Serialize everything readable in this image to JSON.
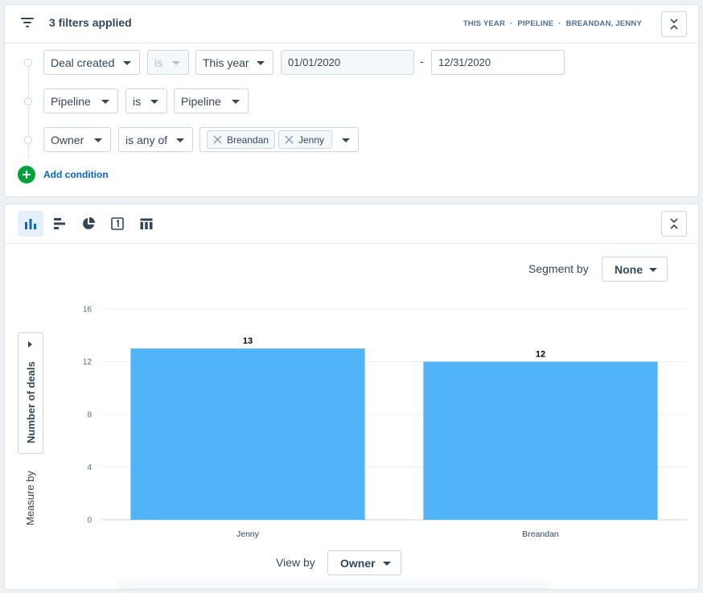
{
  "filters": {
    "title": "3 filters applied",
    "summary": [
      "THIS YEAR",
      "PIPELINE",
      "BREANDAN, JENNY"
    ],
    "rows": [
      {
        "field": "Deal created",
        "operator": "is",
        "value": "This year",
        "date_from": "01/01/2020",
        "date_sep": "-",
        "date_to": "12/31/2020"
      },
      {
        "field": "Pipeline",
        "operator": "is",
        "value": "Pipeline"
      },
      {
        "field": "Owner",
        "operator": "is any of",
        "tags": [
          "Breandan",
          "Jenny"
        ]
      }
    ],
    "add_condition": "Add condition"
  },
  "report": {
    "view_types": [
      "bar-chart-icon",
      "horizontal-bar-icon",
      "pie-chart-icon",
      "single-value-icon",
      "table-icon"
    ],
    "segment_by_label": "Segment by",
    "segment_by_value": "None",
    "measure_value": "Number of deals",
    "measure_by_label": "Measure by",
    "view_by_label": "View by",
    "view_by_value": "Owner"
  },
  "colors": {
    "bar": "#51b3f8",
    "accent": "#0a66c2",
    "add_green": "#00a13b"
  },
  "chart_data": {
    "type": "bar",
    "categories": [
      "Jenny",
      "Breandan"
    ],
    "values": [
      13,
      12
    ],
    "ylabel": "Number of deals",
    "xlabel": "Owner",
    "ylim": [
      0,
      16
    ],
    "yticks": [
      0,
      4,
      8,
      12,
      16
    ],
    "grid": true,
    "data_labels": true
  }
}
